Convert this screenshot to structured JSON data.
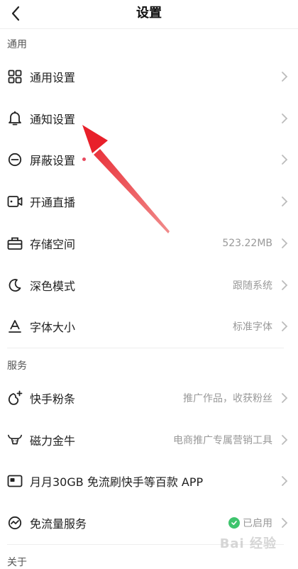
{
  "header": {
    "title": "设置"
  },
  "sections": {
    "general": "通用",
    "service": "服务",
    "about": "关于"
  },
  "rows": {
    "general_settings": {
      "label": "通用设置"
    },
    "notification_settings": {
      "label": "通知设置"
    },
    "block_settings": {
      "label": "屏蔽设置",
      "badge_color": "#e84a5f"
    },
    "live": {
      "label": "开通直播"
    },
    "storage": {
      "label": "存储空间",
      "value": "523.22MB"
    },
    "dark_mode": {
      "label": "深色模式",
      "value": "跟随系统"
    },
    "font_size": {
      "label": "字体大小",
      "value": "标准字体"
    },
    "fans": {
      "label": "快手粉条",
      "value": "推广作品，收获粉丝"
    },
    "magnetic": {
      "label": "磁力金牛",
      "value": "电商推广专属营销工具"
    },
    "data_plan": {
      "label": "月月30GB 免流刷快手等百款 APP"
    },
    "free_data": {
      "label": "免流量服务",
      "value": "已启用",
      "status_color": "#3ec46d"
    }
  },
  "annotation_color": "#e8202a",
  "watermark": "Bai 经验"
}
